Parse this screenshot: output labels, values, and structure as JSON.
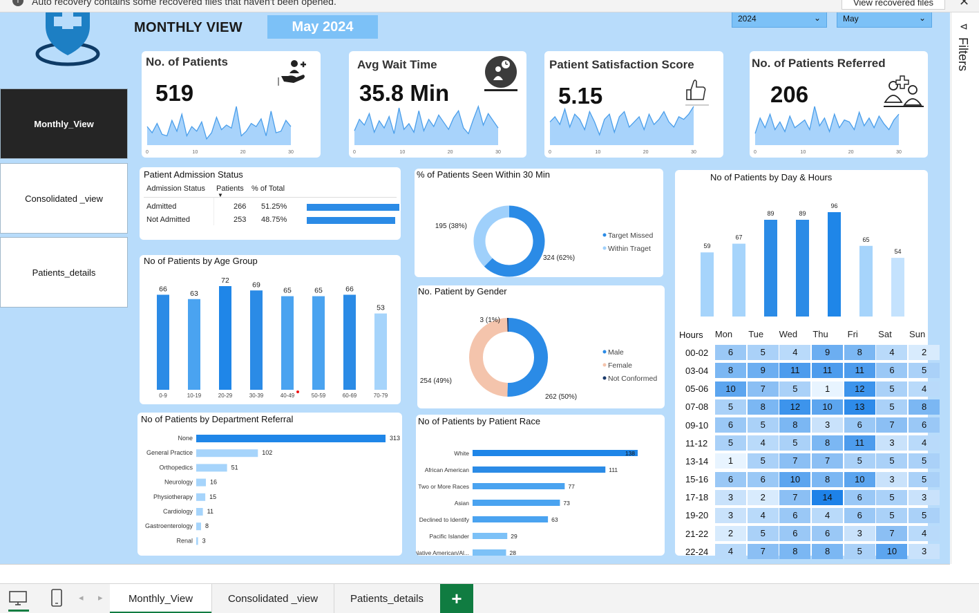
{
  "notification": {
    "message": "Auto recovery contains some recovered files that haven't been opened.",
    "button": "View recovered files"
  },
  "header": {
    "title": "MONTHLY VIEW",
    "month_banner": "May 2024",
    "year_select": "2024",
    "month_select": "May"
  },
  "nav": [
    {
      "label": "Monthly_View",
      "active": true
    },
    {
      "label": "Consolidated _view",
      "active": false
    },
    {
      "label": "Patients_details",
      "active": false
    }
  ],
  "filters": {
    "label": "Filters"
  },
  "kpis": [
    {
      "title": "No. of Patients",
      "value": "519",
      "icon": "patient-hand-icon",
      "spark": [
        12,
        8,
        14,
        7,
        6,
        16,
        9,
        20,
        6,
        12,
        9,
        15,
        4,
        8,
        18,
        10,
        13,
        11,
        25,
        6,
        9,
        14,
        12,
        17,
        6,
        22,
        8,
        9,
        16,
        12
      ],
      "ticks": [
        "0",
        "10",
        "20",
        "30"
      ]
    },
    {
      "title": "Avg Wait Time",
      "value": "35.8 Min",
      "icon": "clock-person-icon",
      "spark": [
        10,
        18,
        14,
        22,
        9,
        17,
        12,
        20,
        8,
        26,
        11,
        15,
        9,
        24,
        10,
        18,
        13,
        21,
        16,
        11,
        19,
        24,
        12,
        8,
        18,
        27,
        14,
        22,
        17,
        12
      ],
      "ticks": [
        "0",
        "10",
        "20",
        "30"
      ]
    },
    {
      "title": "Patient Satisfaction Score",
      "value": "5.15",
      "icon": "thumbs-up-icon",
      "spark": [
        18,
        22,
        16,
        28,
        14,
        24,
        20,
        12,
        26,
        18,
        8,
        20,
        24,
        10,
        22,
        26,
        14,
        18,
        22,
        12,
        24,
        16,
        20,
        26,
        18,
        14,
        22,
        20,
        24,
        30
      ],
      "ticks": [
        "0",
        "10",
        "20",
        "30"
      ]
    },
    {
      "title": "No. of Patients Referred",
      "value": "206",
      "icon": "doctor-referral-icon",
      "spark": [
        6,
        14,
        9,
        16,
        8,
        12,
        7,
        15,
        9,
        11,
        13,
        8,
        20,
        10,
        14,
        7,
        16,
        9,
        13,
        12,
        8,
        17,
        10,
        14,
        9,
        15,
        11,
        8,
        13,
        16
      ],
      "ticks": [
        "0",
        "10",
        "20",
        "30"
      ]
    }
  ],
  "admission": {
    "title": "Patient Admission Status",
    "headers": [
      "Admission Status",
      "Patients",
      "% of Total"
    ],
    "rows": [
      {
        "label": "Admitted",
        "patients": 266,
        "pct": "51.25%",
        "frac": 0.5125
      },
      {
        "label": "Not Admitted",
        "patients": 253,
        "pct": "48.75%",
        "frac": 0.4875
      }
    ]
  },
  "seen30": {
    "title": "% of Patients Seen Within 30 Min",
    "slices": [
      {
        "name": "Target Missed",
        "value": 324,
        "label": "324 (62%)",
        "color": "#2b8be6"
      },
      {
        "name": "Within Traget",
        "value": 195,
        "label": "195 (38%)",
        "color": "#9fd0fb"
      }
    ]
  },
  "gender": {
    "title": "No. Patient by Gender",
    "slices": [
      {
        "name": "Male",
        "value": 262,
        "label": "262 (50%)",
        "color": "#2b8be6"
      },
      {
        "name": "Female",
        "value": 254,
        "label": "254 (49%)",
        "color": "#f4c4ac"
      },
      {
        "name": "Not Conformed",
        "value": 3,
        "label": "3 (1%)",
        "color": "#1b3a6b"
      }
    ]
  },
  "age": {
    "title": "No of Patients by Age Group",
    "categories": [
      "0-9",
      "10-19",
      "20-29",
      "30-39",
      "40-49",
      "50-59",
      "60-69",
      "70-79"
    ],
    "values": [
      66,
      63,
      72,
      69,
      65,
      65,
      66,
      53
    ],
    "colors": [
      "#2b8be6",
      "#4aa3f0",
      "#1f86e8",
      "#2b8be6",
      "#4aa3f0",
      "#4aa3f0",
      "#2b8be6",
      "#a6d4fb"
    ]
  },
  "dept": {
    "title": "No of Patients by Department Referral",
    "categories": [
      "None",
      "General Practice",
      "Orthopedics",
      "Neurology",
      "Physiotherapy",
      "Cardiology",
      "Gastroenterology",
      "Renal"
    ],
    "values": [
      313,
      102,
      51,
      16,
      15,
      11,
      8,
      3
    ]
  },
  "race": {
    "title": "No of Patients by Patient Race",
    "categories": [
      "White",
      "African American",
      "Two or More Races",
      "Asian",
      "Declined to Identify",
      "Pacific Islander",
      "Native American/Al..."
    ],
    "values": [
      138,
      111,
      77,
      73,
      63,
      29,
      28
    ]
  },
  "dayhours": {
    "title": "No of Patients by Day & Hours",
    "days": [
      "Mon",
      "Tue",
      "Wed",
      "Thu",
      "Fri",
      "Sat",
      "Sun"
    ],
    "totals": [
      59,
      67,
      89,
      89,
      96,
      65,
      54
    ],
    "hours_label": "Hours",
    "hours": [
      "00-02",
      "03-04",
      "05-06",
      "07-08",
      "09-10",
      "11-12",
      "13-14",
      "15-16",
      "17-18",
      "19-20",
      "21-22",
      "22-24"
    ],
    "matrix": [
      [
        6,
        5,
        4,
        9,
        8,
        4,
        2
      ],
      [
        8,
        9,
        11,
        11,
        11,
        6,
        5
      ],
      [
        10,
        7,
        5,
        1,
        12,
        5,
        4
      ],
      [
        5,
        8,
        12,
        10,
        13,
        5,
        8
      ],
      [
        6,
        5,
        8,
        3,
        6,
        7,
        6
      ],
      [
        5,
        4,
        5,
        8,
        11,
        3,
        4
      ],
      [
        1,
        5,
        7,
        7,
        5,
        5,
        5
      ],
      [
        6,
        6,
        10,
        8,
        10,
        3,
        5
      ],
      [
        3,
        2,
        7,
        14,
        6,
        5,
        3
      ],
      [
        3,
        4,
        6,
        4,
        6,
        5,
        5
      ],
      [
        2,
        5,
        6,
        6,
        3,
        7,
        4
      ],
      [
        4,
        7,
        8,
        8,
        5,
        10,
        3
      ]
    ]
  },
  "tabs": [
    {
      "label": "Monthly_View",
      "active": true
    },
    {
      "label": "Consolidated _view",
      "active": false
    },
    {
      "label": "Patients_details",
      "active": false
    }
  ],
  "add_tab": "+"
}
